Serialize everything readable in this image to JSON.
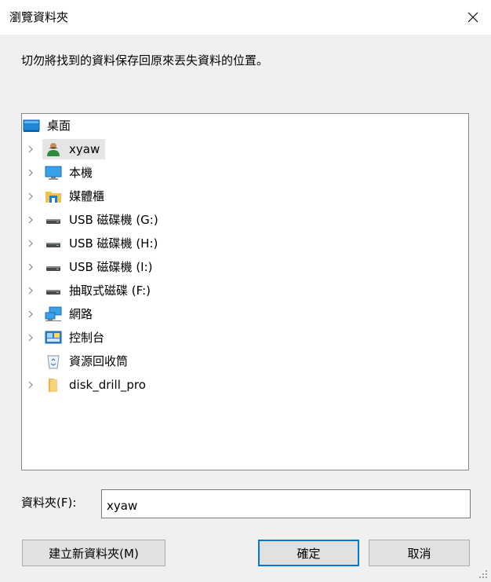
{
  "window": {
    "title": "瀏覽資料夾",
    "close_icon": "close-icon"
  },
  "instruction": "切勿將找到的資料保存回原來丟失資料的位置。",
  "tree": {
    "root": {
      "label": "桌面",
      "icon": "desktop-icon"
    },
    "items": [
      {
        "label": "xyaw",
        "icon": "user-icon",
        "expandable": true,
        "selected": true
      },
      {
        "label": "本機",
        "icon": "computer-icon",
        "expandable": true
      },
      {
        "label": "媒體櫃",
        "icon": "library-icon",
        "expandable": true
      },
      {
        "label": "USB 磁碟機 (G:)",
        "icon": "drive-icon",
        "expandable": true
      },
      {
        "label": "USB 磁碟機 (H:)",
        "icon": "drive-icon",
        "expandable": true
      },
      {
        "label": "USB 磁碟機 (I:)",
        "icon": "drive-icon",
        "expandable": true
      },
      {
        "label": "抽取式磁碟 (F:)",
        "icon": "drive-icon",
        "expandable": true
      },
      {
        "label": "網路",
        "icon": "network-icon",
        "expandable": true
      },
      {
        "label": "控制台",
        "icon": "control-panel-icon",
        "expandable": true
      },
      {
        "label": "資源回收筒",
        "icon": "recycle-bin-icon",
        "expandable": false
      },
      {
        "label": "disk_drill_pro",
        "icon": "folder-icon",
        "expandable": true
      }
    ]
  },
  "folder_field": {
    "label": "資料夾(F):",
    "value": "xyaw"
  },
  "buttons": {
    "new_folder": "建立新資料夾(M)",
    "ok": "確定",
    "cancel": "取消"
  },
  "colors": {
    "accent": "#0078d7",
    "selection": "#e5e5e5",
    "background": "#f0f0f0"
  }
}
